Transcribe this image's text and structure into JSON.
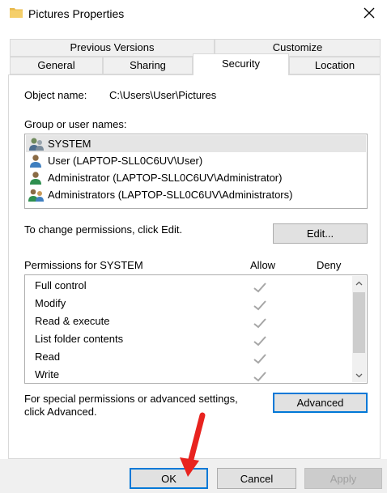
{
  "window": {
    "title": "Pictures Properties"
  },
  "tabs_row1": [
    {
      "label": "Previous Versions"
    },
    {
      "label": "Customize"
    }
  ],
  "tabs_row2": [
    {
      "label": "General"
    },
    {
      "label": "Sharing"
    },
    {
      "label": "Security",
      "active": true
    },
    {
      "label": "Location"
    }
  ],
  "security": {
    "object_name_label": "Object name:",
    "object_name_value": "C:\\Users\\User\\Pictures",
    "group_label": "Group or user names:",
    "users": [
      {
        "name": "SYSTEM",
        "icon": "system-user-icon",
        "selected": true
      },
      {
        "name": "User (LAPTOP-SLL0C6UV\\User)",
        "icon": "user-icon"
      },
      {
        "name": "Administrator (LAPTOP-SLL0C6UV\\Administrator)",
        "icon": "user-icon"
      },
      {
        "name": "Administrators (LAPTOP-SLL0C6UV\\Administrators)",
        "icon": "group-icon"
      }
    ],
    "change_permissions_text": "To change permissions, click Edit.",
    "edit_button": "Edit...",
    "permissions_label": "Permissions for SYSTEM",
    "allow_header": "Allow",
    "deny_header": "Deny",
    "permissions": [
      {
        "name": "Full control",
        "allow": true,
        "deny": false
      },
      {
        "name": "Modify",
        "allow": true,
        "deny": false
      },
      {
        "name": "Read & execute",
        "allow": true,
        "deny": false
      },
      {
        "name": "List folder contents",
        "allow": true,
        "deny": false
      },
      {
        "name": "Read",
        "allow": true,
        "deny": false
      },
      {
        "name": "Write",
        "allow": true,
        "deny": false
      }
    ],
    "special_text_line1": "For special permissions or advanced settings,",
    "special_text_line2": "click Advanced.",
    "advanced_button": "Advanced"
  },
  "footer": {
    "ok": "OK",
    "cancel": "Cancel",
    "apply": "Apply"
  },
  "colors": {
    "accent": "#0078d7",
    "annotation_arrow": "#e8231f"
  }
}
